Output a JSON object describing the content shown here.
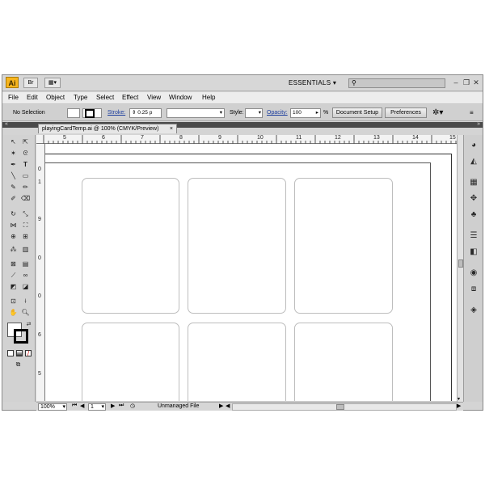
{
  "app": {
    "logo": "Ai",
    "bridge_label": "Br",
    "workspace": "ESSENTIALS",
    "window_controls": [
      "minimize-icon",
      "restore-icon",
      "close-icon"
    ]
  },
  "menu": [
    "File",
    "Edit",
    "Object",
    "Type",
    "Select",
    "Effect",
    "View",
    "Window",
    "Help"
  ],
  "control_bar": {
    "selection": "No Selection",
    "stroke_label": "Stroke:",
    "stroke_value": "0.25 p",
    "style_label": "Style:",
    "opacity_label": "Opacity:",
    "opacity_value": "100",
    "opacity_unit": "%",
    "doc_setup": "Document Setup",
    "preferences": "Preferences"
  },
  "document": {
    "tab_title": "playingCardTemp.ai @ 100% (CMYK/Preview)",
    "close": "×"
  },
  "rulers": {
    "h": [
      "5",
      "6",
      "7",
      "8",
      "9",
      "10",
      "11",
      "12",
      "13",
      "14",
      "15"
    ],
    "v": [
      "0",
      "1",
      "9",
      "0",
      "0",
      "6",
      "5"
    ]
  },
  "status": {
    "zoom": "100%",
    "page": "1",
    "file_state": "Unmanaged File"
  },
  "colors": {
    "accent_logo": "#f7b51e",
    "link_blue": "#1d3e9e",
    "card_border": "#bdbdbd"
  }
}
